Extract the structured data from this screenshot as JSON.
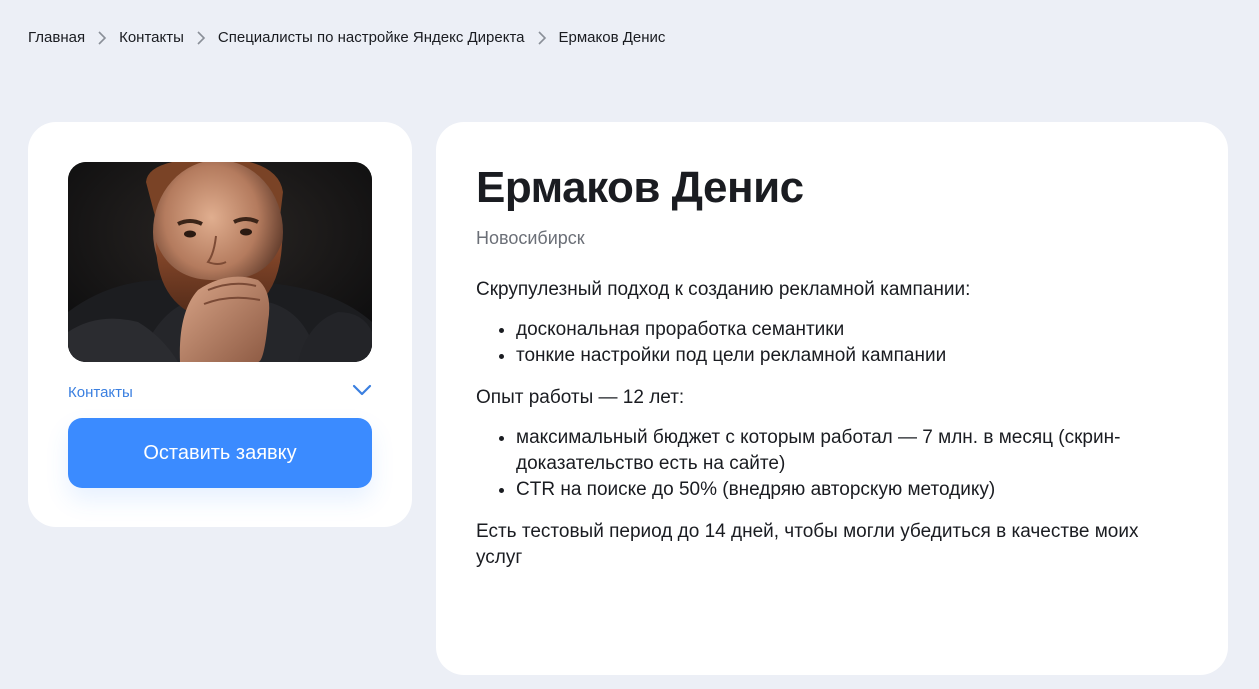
{
  "breadcrumb": {
    "items": [
      "Главная",
      "Контакты",
      "Специалисты по настройке Яндекс Директа"
    ],
    "current": "Ермаков Денис"
  },
  "profile": {
    "contacts_label": "Контакты",
    "cta_label": "Оставить заявку"
  },
  "main": {
    "name": "Ермаков Денис",
    "city": "Новосибирск",
    "intro": "Скрупулезный подход к созданию рекламной кампании:",
    "list1": [
      "доскональная проработка семантики",
      "тонкие настройки под цели рекламной кампании"
    ],
    "experience": "Опыт работы — 12 лет:",
    "list2": [
      "максимальный бюджет с которым работал — 7 млн. в месяц (скрин-доказательство есть на сайте)",
      "CTR на поиске до 50% (внедряю авторскую методику)"
    ],
    "outro": "Есть тестовый период до 14 дней, чтобы могли убедиться в качестве моих услуг"
  },
  "colors": {
    "page_bg": "#eceff6",
    "accent": "#3b8bff",
    "link": "#3a7fe0"
  }
}
